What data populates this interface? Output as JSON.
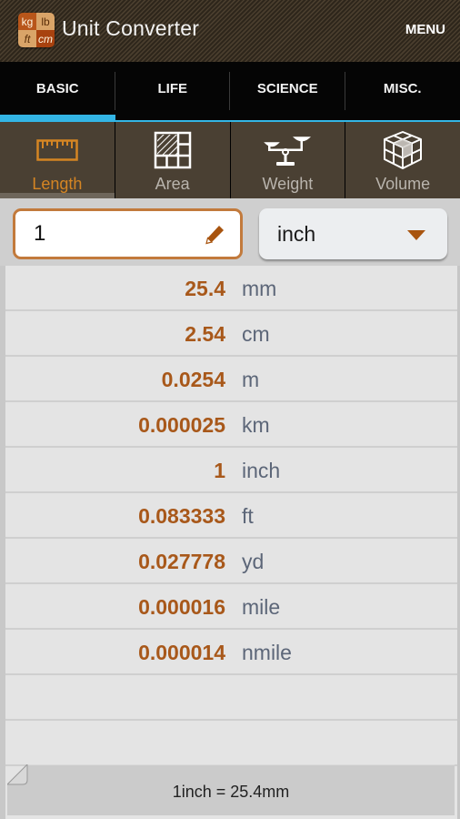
{
  "app": {
    "title": "Unit Converter",
    "menu_label": "MENU",
    "logo": {
      "cells": [
        "kg",
        "lb",
        "ft",
        "cm"
      ],
      "icon": "unit-converter-logo-icon"
    }
  },
  "tabs": [
    {
      "label": "BASIC",
      "active": true
    },
    {
      "label": "LIFE",
      "active": false
    },
    {
      "label": "SCIENCE",
      "active": false
    },
    {
      "label": "MISC.",
      "active": false
    }
  ],
  "categories": [
    {
      "label": "Length",
      "icon": "ruler-icon",
      "active": true
    },
    {
      "label": "Area",
      "icon": "area-grid-icon",
      "active": false
    },
    {
      "label": "Weight",
      "icon": "scale-icon",
      "active": false
    },
    {
      "label": "Volume",
      "icon": "cube-icon",
      "active": false
    }
  ],
  "input": {
    "value": "1",
    "edit_icon": "pencil-icon",
    "unit": "inch",
    "dropdown_icon": "caret-down-icon"
  },
  "results": [
    {
      "value": "25.4",
      "unit": "mm"
    },
    {
      "value": "2.54",
      "unit": "cm"
    },
    {
      "value": "0.0254",
      "unit": "m"
    },
    {
      "value": "0.000025",
      "unit": "km"
    },
    {
      "value": "1",
      "unit": "inch"
    },
    {
      "value": "0.083333",
      "unit": "ft"
    },
    {
      "value": "0.027778",
      "unit": "yd"
    },
    {
      "value": "0.000016",
      "unit": "mile"
    },
    {
      "value": "0.000014",
      "unit": "nmile"
    },
    {
      "value": "",
      "unit": ""
    },
    {
      "value": "",
      "unit": ""
    }
  ],
  "footer": {
    "formula": "1inch = 25.4mm"
  },
  "colors": {
    "accent_tab": "#33b5e5",
    "accent_orange": "#d58523",
    "value_text": "#a8581a",
    "unit_text": "#5c6678"
  }
}
